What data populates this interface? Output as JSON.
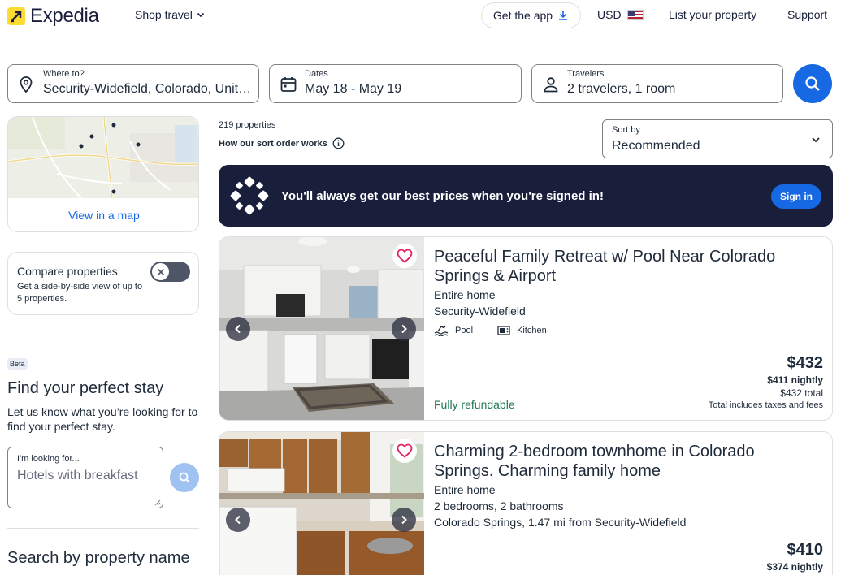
{
  "header": {
    "logo_text": "Expedia",
    "shop_travel": "Shop travel",
    "get_app": "Get the app",
    "currency": "USD",
    "list_property": "List your property",
    "support": "Support"
  },
  "search": {
    "where_label": "Where to?",
    "where_value": "Security-Widefield, Colorado, United States",
    "dates_label": "Dates",
    "dates_value": "May 18 - May 19",
    "travelers_label": "Travelers",
    "travelers_value": "2 travelers, 1 room"
  },
  "sidebar": {
    "map_link": "View in a map",
    "compare_title": "Compare properties",
    "compare_desc": "Get a side-by-side view of up to 5 properties.",
    "beta": "Beta",
    "find_title": "Find your perfect stay",
    "find_desc": "Let us know what you’re looking for to find your perfect stay.",
    "looking_label": "I'm looking for...",
    "looking_placeholder": "Hotels with breakfast",
    "search_name_title": "Search by property name"
  },
  "results": {
    "count": "219 properties",
    "sort_order": "How our sort order works",
    "sort_label": "Sort by",
    "sort_value": "Recommended",
    "banner_text": "You'll always get our best prices when you're signed in!",
    "banner_button": "Sign in"
  },
  "listings": [
    {
      "title": "Peaceful Family Retreat w/ Pool Near Colorado Springs & Airport",
      "type": "Entire home",
      "location": "Security-Widefield",
      "amenities": [
        "Pool",
        "Kitchen"
      ],
      "refund": "Fully refundable",
      "price": "$432",
      "nightly": "$411 nightly",
      "total": "$432 total",
      "fees": "Total includes taxes and fees"
    },
    {
      "title": "Charming 2-bedroom townhome in Colorado Springs. Charming family home",
      "type": "Entire home",
      "rooms": "2 bedrooms, 2 bathrooms",
      "location": "Colorado Springs, 1.47 mi from Security-Widefield",
      "price": "$410",
      "nightly": "$374 nightly"
    }
  ],
  "colors": {
    "brand_blue": "#1668e3",
    "banner_navy": "#191e3b",
    "refund_green": "#227950",
    "logo_yellow": "#fddb32"
  },
  "icons": [
    "location-pin-icon",
    "calendar-icon",
    "person-icon",
    "search-icon",
    "download-icon",
    "chevron-down-icon",
    "info-icon",
    "heart-icon",
    "chevron-left-icon",
    "chevron-right-icon",
    "pool-icon",
    "kitchen-icon",
    "close-icon",
    "sparkle-icon"
  ]
}
